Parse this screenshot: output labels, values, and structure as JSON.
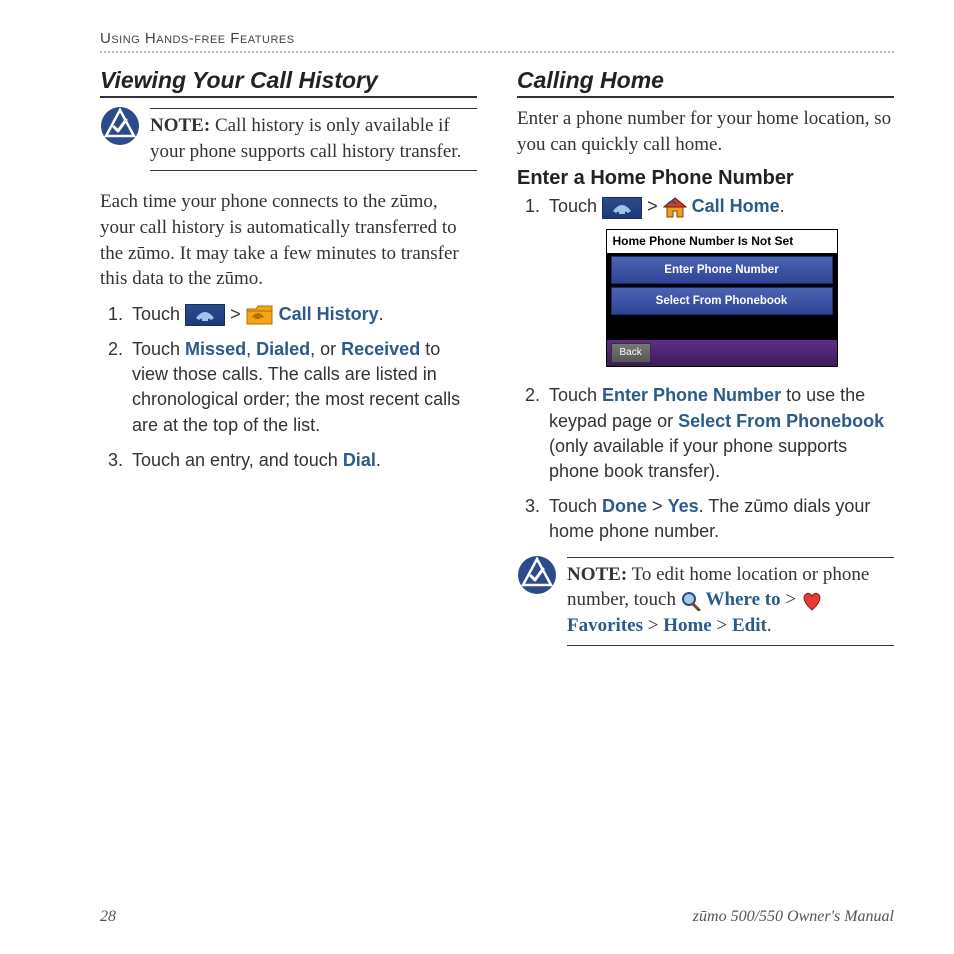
{
  "header": {
    "running": "Using Hands-free Features"
  },
  "left": {
    "heading": "Viewing Your Call History",
    "note": {
      "label": "NOTE:",
      "text": " Call history is only available if your phone supports call history transfer."
    },
    "para": "Each time your phone connects to the zūmo, your call history is automatically transferred to the zūmo. It may take a few minutes to transfer this data to the zūmo.",
    "steps": {
      "s1": {
        "pre": "Touch ",
        "sep": " > ",
        "kw": "Call History",
        "post": "."
      },
      "s2": {
        "pre": "Touch ",
        "k1": "Missed",
        "k2": "Dialed",
        "k3": "Received",
        "post": " to view those calls. The calls are listed in chronological order; the most recent calls are at the top of the list."
      },
      "s3": {
        "pre": "Touch an entry, and touch ",
        "k1": "Dial",
        "post": "."
      }
    }
  },
  "right": {
    "heading": "Calling Home",
    "intro": "Enter a phone number for your home location, so you can quickly call home.",
    "subheading": "Enter a Home Phone Number",
    "step1": {
      "pre": "Touch ",
      "sep": " > ",
      "kw": "Call Home",
      "post": "."
    },
    "screenshot": {
      "title": "Home Phone Number Is Not Set",
      "btn1": "Enter Phone Number",
      "btn2": "Select From Phonebook",
      "back": "Back"
    },
    "step2": {
      "pre": "Touch ",
      "k1": "Enter Phone Number",
      "mid1": " to use the keypad page or ",
      "k2": "Select From Phonebook",
      "mid2": " (only available if your phone supports phone book transfer)."
    },
    "step3": {
      "pre": "Touch ",
      "k1": "Done",
      "sep": " > ",
      "k2": "Yes",
      "post": ". The zūmo dials your home phone number."
    },
    "note2": {
      "label": "NOTE:",
      "pre": " To edit home location or phone number, touch ",
      "k1": "Where to",
      "sep1": " > ",
      "k2": "Favorites",
      "sep2": " > ",
      "k3": "Home",
      "sep3": " > ",
      "k4": "Edit",
      "post": "."
    }
  },
  "footer": {
    "page": "28",
    "manual": "zūmo 500/550 Owner's Manual"
  }
}
